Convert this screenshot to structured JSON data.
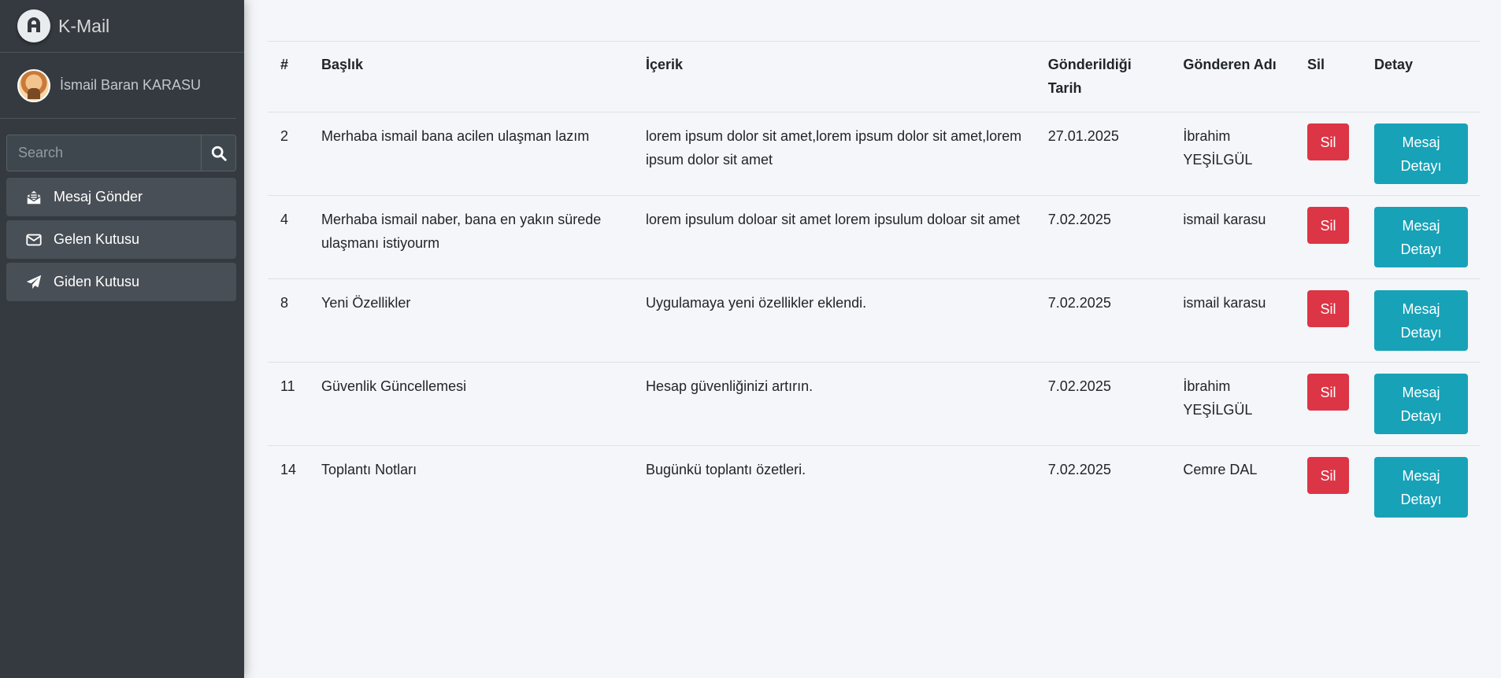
{
  "brand": {
    "name": "K-Mail",
    "logo_icon": "logo-icon"
  },
  "user": {
    "name": "İsmail Baran KARASU"
  },
  "search": {
    "placeholder": "Search"
  },
  "nav": [
    {
      "label": "Mesaj Gönder",
      "icon": "envelope-open-text-icon"
    },
    {
      "label": "Gelen Kutusu",
      "icon": "envelope-icon"
    },
    {
      "label": "Giden Kutusu",
      "icon": "paper-plane-icon"
    }
  ],
  "table": {
    "headers": {
      "num": "#",
      "title": "Başlık",
      "content": "İçerik",
      "date": "Gönderildiği Tarih",
      "sender": "Gönderen Adı",
      "delete": "Sil",
      "detail": "Detay"
    },
    "rows": [
      {
        "num": "2",
        "title": "Merhaba ismail bana acilen ulaşman lazım",
        "content": "lorem ipsum dolor sit amet,lorem ipsum dolor sit amet,lorem ipsum dolor sit amet",
        "date": "27.01.2025",
        "sender": "İbrahim YEŞİLGÜL",
        "delete_label": "Sil",
        "detail_label": "Mesaj Detayı"
      },
      {
        "num": "4",
        "title": "Merhaba ismail naber, bana en yakın sürede ulaşmanı istiyourm",
        "content": "lorem ipsulum doloar sit amet lorem ipsulum doloar sit amet",
        "date": "7.02.2025",
        "sender": "ismail karasu",
        "delete_label": "Sil",
        "detail_label": "Mesaj Detayı"
      },
      {
        "num": "8",
        "title": "Yeni Özellikler",
        "content": "Uygulamaya yeni özellikler eklendi.",
        "date": "7.02.2025",
        "sender": "ismail karasu",
        "delete_label": "Sil",
        "detail_label": "Mesaj Detayı"
      },
      {
        "num": "11",
        "title": "Güvenlik Güncellemesi",
        "content": "Hesap güvenliğinizi artırın.",
        "date": "7.02.2025",
        "sender": "İbrahim YEŞİLGÜL",
        "delete_label": "Sil",
        "detail_label": "Mesaj Detayı"
      },
      {
        "num": "14",
        "title": "Toplantı Notları",
        "content": "Bugünkü toplantı özetleri.",
        "date": "7.02.2025",
        "sender": "Cemre DAL",
        "delete_label": "Sil",
        "detail_label": "Mesaj Detayı"
      }
    ]
  },
  "colors": {
    "sidebar_bg": "#343a40",
    "danger": "#dc3545",
    "info": "#17a2b8",
    "page_bg": "#f4f6f9"
  }
}
